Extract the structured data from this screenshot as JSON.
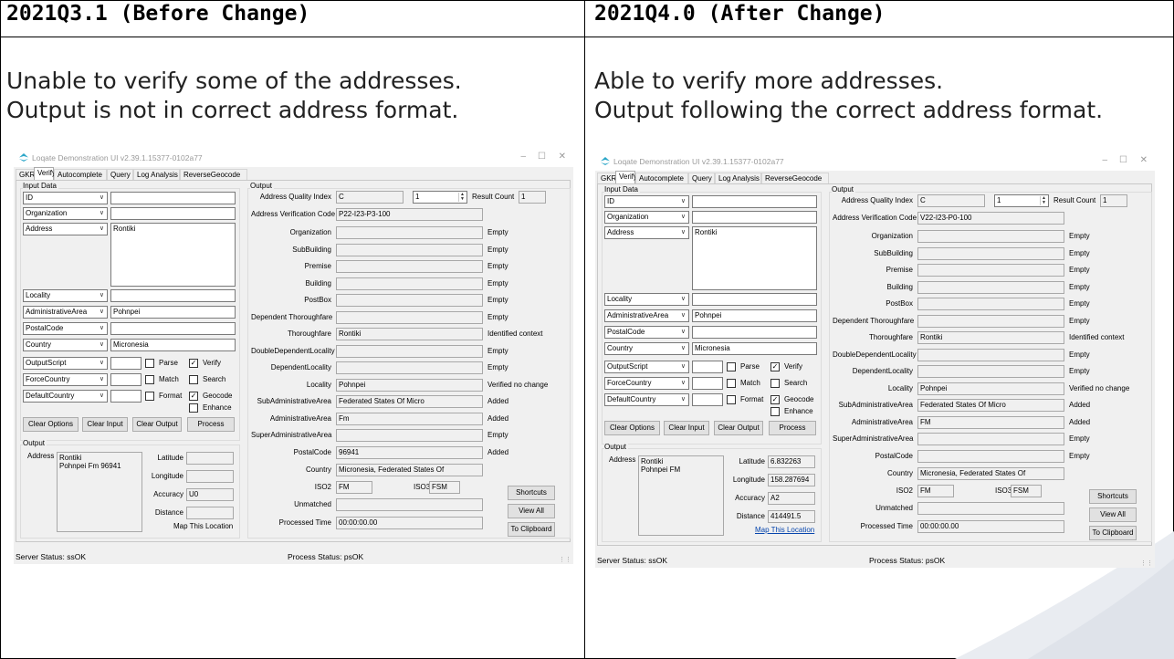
{
  "headings": {
    "before": "2021Q3.1 (Before Change)",
    "after": "2021Q4.0 (After Change)"
  },
  "descriptions": {
    "before_line1": "Unable to verify some of the addresses.",
    "before_line2": "Output is not in correct address format.",
    "after_line1": "Able to verify more addresses.",
    "after_line2": "Output following the correct address format."
  },
  "window": {
    "title": "Loqate Demonstration UI v2.39.1.15377-0102a77",
    "minimize_glyph": "–",
    "maximize_glyph": "☐",
    "close_glyph": "✕"
  },
  "tabs": [
    "GKR",
    "Verify",
    "Autocomplete",
    "Query",
    "Log Analysis",
    "ReverseGeocode"
  ],
  "input": {
    "group_label": "Input Data",
    "rows": [
      {
        "field": "ID",
        "value": ""
      },
      {
        "field": "Organization",
        "value": ""
      },
      {
        "field": "Address",
        "value": "Rontiki"
      },
      {
        "field": "Locality",
        "value": ""
      },
      {
        "field": "AdministrativeArea",
        "value": "Pohnpei"
      },
      {
        "field": "PostalCode",
        "value": ""
      },
      {
        "field": "Country",
        "value": "Micronesia"
      }
    ],
    "option_rows": [
      {
        "field": "OutputScript",
        "value": ""
      },
      {
        "field": "ForceCountry",
        "value": ""
      },
      {
        "field": "DefaultCountry",
        "value": ""
      }
    ],
    "checkboxes": {
      "parse": "Parse",
      "match": "Match",
      "format": "Format",
      "verify": "Verify",
      "search": "Search",
      "geocode": "Geocode",
      "enhance": "Enhance"
    },
    "check_glyph": "✓",
    "buttons": {
      "clear_options": "Clear Options",
      "clear_input": "Clear Input",
      "clear_output": "Clear Output",
      "process": "Process"
    }
  },
  "output_box": {
    "group_label": "Output",
    "address_label": "Address",
    "latitude_label": "Latitude",
    "longitude_label": "Longitude",
    "accuracy_label": "Accuracy",
    "distance_label": "Distance",
    "map_label": "Map This Location"
  },
  "output": {
    "group_label": "Output",
    "aqi_label": "Address Quality Index",
    "result_count_label": "Result Count",
    "avc_label": "Address Verification Code",
    "field_labels": [
      "Organization",
      "SubBuilding",
      "Premise",
      "Building",
      "PostBox",
      "Dependent Thoroughfare",
      "Thoroughfare",
      "DoubleDependentLocality",
      "DependentLocality",
      "Locality",
      "SubAdministrativeArea",
      "AdministrativeArea",
      "SuperAdministrativeArea",
      "PostalCode"
    ],
    "country_label": "Country",
    "iso2_label": "ISO2",
    "iso3_label": "ISO3",
    "unmatched_label": "Unmatched",
    "processed_time_label": "Processed Time",
    "buttons": {
      "shortcuts": "Shortcuts",
      "view_all": "View All",
      "to_clipboard": "To Clipboard"
    }
  },
  "before": {
    "aqi": "C",
    "spin": "1",
    "result_count": "1",
    "avc": "P22-I23-P3-100",
    "field_values": [
      "",
      "",
      "",
      "",
      "",
      "",
      "Rontiki",
      "",
      "",
      "Pohnpei",
      "Federated States Of Micro",
      "Fm",
      "",
      "96941"
    ],
    "field_status": [
      "Empty",
      "Empty",
      "Empty",
      "Empty",
      "Empty",
      "Empty",
      "Identified context",
      "Empty",
      "Empty",
      "Verified no change",
      "Added",
      "Added",
      "Empty",
      "Added"
    ],
    "country": "Micronesia, Federated States Of",
    "iso2": "FM",
    "iso3": "FSM",
    "unmatched": "",
    "processed_time": "00:00:00.00",
    "address_out": "Rontiki\nPohnpei Fm 96941",
    "latitude": "",
    "longitude": "",
    "accuracy": "U0",
    "distance": "",
    "status_server": "Server Status: ssOK",
    "status_process": "Process Status: psOK"
  },
  "after": {
    "aqi": "C",
    "spin": "1",
    "result_count": "1",
    "avc": "V22-I23-P0-100",
    "field_values": [
      "",
      "",
      "",
      "",
      "",
      "",
      "Rontiki",
      "",
      "",
      "Pohnpei",
      "Federated States Of Micro",
      "FM",
      "",
      ""
    ],
    "field_status": [
      "Empty",
      "Empty",
      "Empty",
      "Empty",
      "Empty",
      "Empty",
      "Identified context",
      "Empty",
      "Empty",
      "Verified no change",
      "Added",
      "Added",
      "Empty",
      "Empty"
    ],
    "country": "Micronesia, Federated States Of",
    "iso2": "FM",
    "iso3": "FSM",
    "unmatched": "",
    "processed_time": "00:00:00.00",
    "address_out": "Rontiki\nPohnpei FM",
    "latitude": "6.832263",
    "longitude": "158.287694",
    "accuracy": "A2",
    "distance": "414491.5",
    "status_server": "Server Status: ssOK",
    "status_process": "Process Status: psOK"
  },
  "colors": {
    "logo": "#2aa6c8",
    "link": "#0645ad",
    "decoration": "#e9ecf1"
  }
}
